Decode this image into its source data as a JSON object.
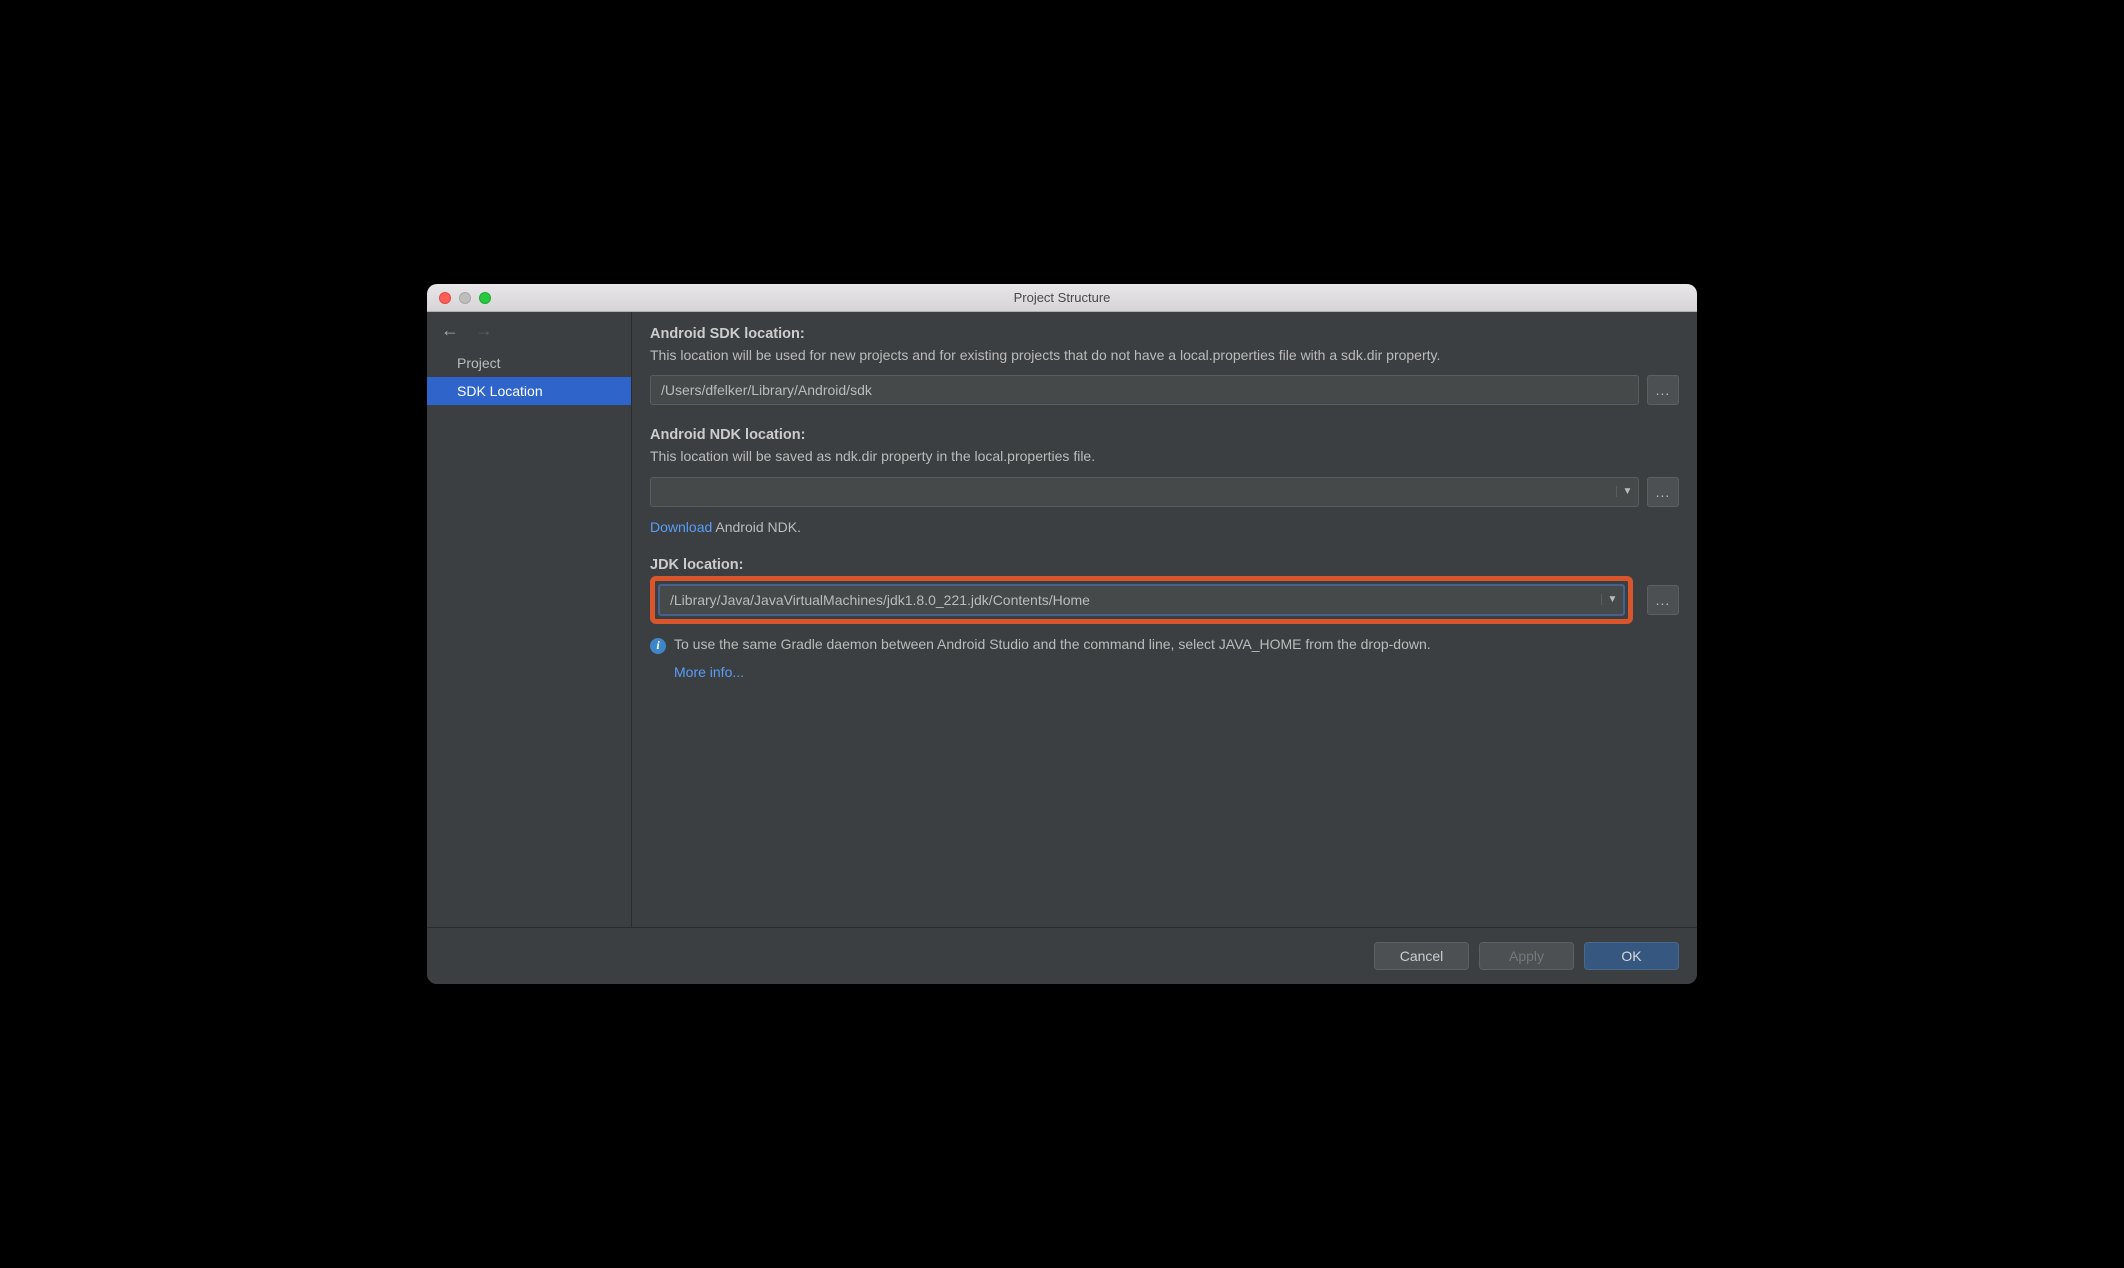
{
  "window": {
    "title": "Project Structure"
  },
  "sidebar": {
    "items": [
      {
        "label": "Project",
        "selected": false
      },
      {
        "label": "SDK Location",
        "selected": true
      }
    ]
  },
  "sections": {
    "sdk": {
      "title": "Android SDK location:",
      "description": "This location will be used for new projects and for existing projects that do not have a local.properties file with a sdk.dir property.",
      "value": "/Users/dfelker/Library/Android/sdk"
    },
    "ndk": {
      "title": "Android NDK location:",
      "description": "This location will be saved as ndk.dir property in the local.properties file.",
      "value": "",
      "download_link": "Download",
      "download_suffix": " Android NDK."
    },
    "jdk": {
      "title": "JDK location:",
      "value": "/Library/Java/JavaVirtualMachines/jdk1.8.0_221.jdk/Contents/Home",
      "info_text": "To use the same Gradle daemon between Android Studio and the command line, select JAVA_HOME from the drop-down.",
      "more_info": "More info..."
    }
  },
  "footer": {
    "cancel": "Cancel",
    "apply": "Apply",
    "ok": "OK"
  },
  "icons": {
    "ellipsis": "...",
    "dropdown": "▼",
    "info": "i"
  }
}
